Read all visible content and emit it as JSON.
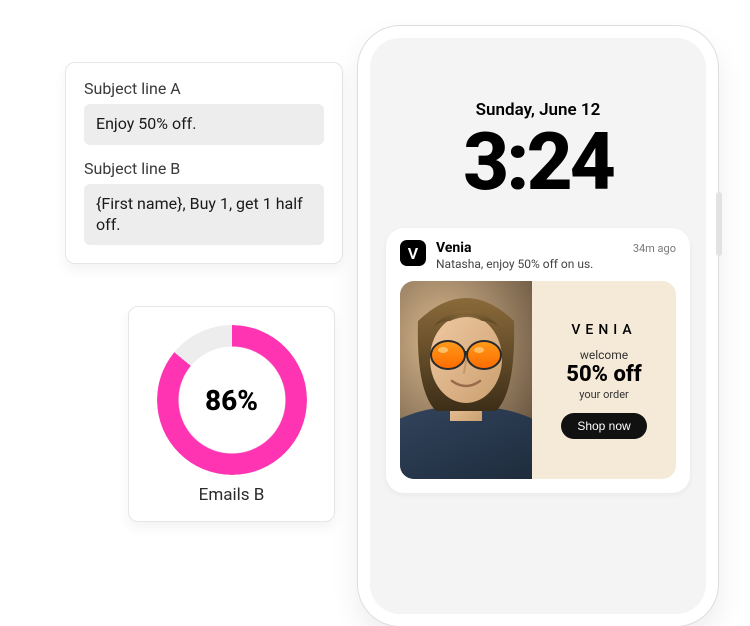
{
  "subject": {
    "a": {
      "label": "Subject line A",
      "value": "Enjoy 50% off."
    },
    "b": {
      "label": "Subject line B",
      "value": "{First name}, Buy 1, get 1 half off."
    }
  },
  "stats": {
    "percent_value": 86,
    "percent_display": "86%",
    "label": "Emails B",
    "ring_color": "#FF34B3",
    "track_color": "#ededed"
  },
  "phone": {
    "date": "Sunday, June 12",
    "time": "3:24",
    "notification": {
      "app_initial": "V",
      "app_name": "Venia",
      "time": "34m ago",
      "message": "Natasha, enjoy 50% off on us."
    },
    "promo": {
      "brand": "VENIA",
      "welcome": "welcome",
      "headline": "50% off",
      "sub": "your order",
      "cta": "Shop now"
    }
  }
}
